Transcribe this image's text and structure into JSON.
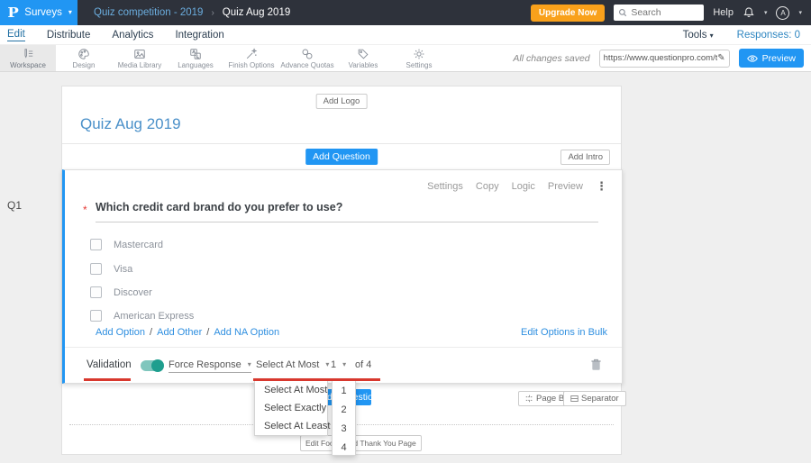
{
  "topbar": {
    "logo": "P",
    "product": "Surveys",
    "breadcrumb": {
      "parent": "Quiz competition - 2019",
      "separator": "›",
      "current": "Quiz Aug 2019"
    },
    "upgrade_label": "Upgrade Now",
    "search_placeholder": "Search",
    "help_label": "Help",
    "avatar_initial": "A"
  },
  "nav": {
    "items": [
      {
        "label": "Edit"
      },
      {
        "label": "Distribute"
      },
      {
        "label": "Analytics"
      },
      {
        "label": "Integration"
      }
    ],
    "tools_label": "Tools",
    "responses_label": "Responses: 0"
  },
  "toolbar": {
    "items": [
      {
        "label": "Workspace"
      },
      {
        "label": "Design"
      },
      {
        "label": "Media Library"
      },
      {
        "label": "Languages"
      },
      {
        "label": "Finish Options"
      },
      {
        "label": "Advance Quotas"
      },
      {
        "label": "Variables"
      },
      {
        "label": "Settings"
      }
    ],
    "saved_status": "All changes saved",
    "url_value": "https://www.questionpro.com/t/APNrFZ",
    "preview_label": "Preview"
  },
  "survey": {
    "add_logo_label": "Add Logo",
    "title": "Quiz Aug 2019",
    "add_question_label": "Add Question",
    "add_intro_label": "Add Intro",
    "question": {
      "id_label": "Q1",
      "actions": [
        {
          "label": "Settings"
        },
        {
          "label": "Copy"
        },
        {
          "label": "Logic"
        },
        {
          "label": "Preview"
        }
      ],
      "required_marker": "*",
      "text": "Which credit card brand do you prefer to use?",
      "options": [
        {
          "label": "Mastercard"
        },
        {
          "label": "Visa"
        },
        {
          "label": "Discover"
        },
        {
          "label": "American Express"
        }
      ],
      "add_option_label": "Add Option",
      "add_other_label": "Add Other",
      "add_na_label": "Add NA Option",
      "links_separator": "/",
      "bulk_link_label": "Edit Options in Bulk",
      "validation": {
        "label": "Validation",
        "force_response_label": "Force Response",
        "rule_value": "Select At Most",
        "count_value": "1",
        "of_label": "of 4"
      }
    },
    "rule_dropdown": {
      "items": [
        {
          "label": "Select At Most"
        },
        {
          "label": "Select Exactly"
        },
        {
          "label": "Select At Least"
        }
      ]
    },
    "count_dropdown": {
      "items": [
        {
          "label": "1"
        },
        {
          "label": "2"
        },
        {
          "label": "3"
        },
        {
          "label": "4"
        }
      ]
    },
    "page_break_label": "Page Break",
    "separator_label": "Separator",
    "footer_button_label": "Edit Footer and Thank You Page"
  },
  "colors": {
    "brand_blue": "#2196f3",
    "topbar_dark": "#2e323b",
    "upgrade_orange": "#f9a11b",
    "title_blue": "#4a90c9",
    "annotation_red": "#d8382e",
    "toggle_teal": "#1e9e8e",
    "required_red": "#e53935"
  }
}
